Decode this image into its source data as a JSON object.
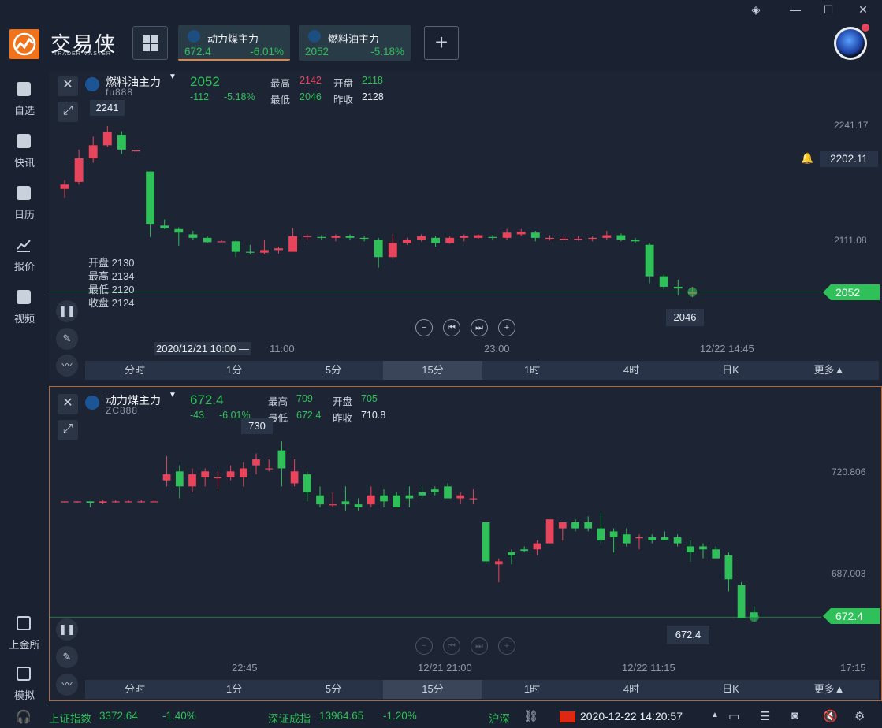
{
  "app": {
    "logo_text": "交易侠",
    "logo_sub": "TRADER MASTER"
  },
  "tabs": [
    {
      "name": "动力煤主力",
      "price": "672.4",
      "pct": "-6.01%"
    },
    {
      "name": "燃料油主力",
      "price": "2052",
      "pct": "-5.18%"
    }
  ],
  "add_tab_label": "+",
  "sidebar": [
    {
      "label": "自选"
    },
    {
      "label": "快讯"
    },
    {
      "label": "日历"
    },
    {
      "label": "报价"
    },
    {
      "label": "视频"
    },
    {
      "label": "上金所"
    },
    {
      "label": "模拟"
    }
  ],
  "panel1": {
    "name": "燃料油主力",
    "code": "fu888",
    "price": "2052",
    "change": "-112",
    "pct": "-5.18%",
    "high_label": "最高",
    "high": "2142",
    "low_label": "最低",
    "low": "2046",
    "open_label": "开盘",
    "open": "2118",
    "prev_label": "昨收",
    "prev": "2128",
    "max_tip": "2241",
    "min_tip": "2046",
    "y_labels": [
      "2241.17",
      "2111.08"
    ],
    "alert_price": "2202.11",
    "last_tag": "2052",
    "ohlc": [
      "开盘 2130",
      "最高 2134",
      "最低 2120",
      "收盘 2124"
    ],
    "x_labels": [
      "2020/12/21 10:00 —",
      "11:00",
      "23:00",
      "12/22 14:45"
    ],
    "timeframes": [
      "分时",
      "1分",
      "5分",
      "15分",
      "1时",
      "4时",
      "日K",
      "更多▲"
    ],
    "active_tf": "15分",
    "up_color": "#e8455d",
    "down_color": "#2fc05a"
  },
  "panel2": {
    "name": "动力煤主力",
    "code": "ZC888",
    "price": "672.4",
    "change": "-43",
    "pct": "-6.01%",
    "high_label": "最高",
    "high": "709",
    "low_label": "最低",
    "low": "672.4",
    "open_label": "开盘",
    "open": "705",
    "prev_label": "昨收",
    "prev": "710.8",
    "max_tip": "730",
    "min_tip": "672.4",
    "y_labels": [
      "720.806",
      "687.003"
    ],
    "last_tag": "672.4",
    "x_labels": [
      "22:45",
      "12/21 21:00",
      "12/22 11:15",
      "17:15"
    ],
    "timeframes": [
      "分时",
      "1分",
      "5分",
      "15分",
      "1时",
      "4时",
      "日K",
      "更多▲"
    ],
    "active_tf": "15分"
  },
  "statusbar": {
    "idx1_name": "上证指数",
    "idx1_val": "3372.64",
    "idx1_pct": "-1.40%",
    "idx2_name": "深证成指",
    "idx2_val": "13964.65",
    "idx2_pct": "-1.20%",
    "idx3_name": "沪深",
    "datetime": "2020-12-22 14:20:57"
  },
  "chart_data": [
    {
      "type": "candlestick",
      "title": "燃料油主力",
      "ylim": [
        2030,
        2260
      ],
      "candles": [
        [
          2170,
          2180,
          2160,
          2175
        ],
        [
          2178,
          2215,
          2175,
          2205
        ],
        [
          2205,
          2230,
          2200,
          2220
        ],
        [
          2220,
          2242,
          2218,
          2235
        ],
        [
          2232,
          2236,
          2210,
          2215
        ],
        [
          2214,
          2215,
          2212,
          2214
        ],
        [
          2190,
          2190,
          2115,
          2130
        ],
        [
          2128,
          2135,
          2124,
          2125
        ],
        [
          2124,
          2126,
          2105,
          2120
        ],
        [
          2118,
          2122,
          2112,
          2114
        ],
        [
          2114,
          2116,
          2108,
          2109
        ],
        [
          2110,
          2112,
          2109,
          2110
        ],
        [
          2110,
          2112,
          2092,
          2098
        ],
        [
          2098,
          2106,
          2095,
          2097
        ],
        [
          2097,
          2112,
          2095,
          2100
        ],
        [
          2100,
          2104,
          2096,
          2102
        ],
        [
          2098,
          2125,
          2098,
          2116
        ],
        [
          2115,
          2118,
          2111,
          2116
        ],
        [
          2115,
          2117,
          2112,
          2114
        ],
        [
          2114,
          2118,
          2110,
          2116
        ],
        [
          2116,
          2118,
          2112,
          2114
        ],
        [
          2114,
          2116,
          2110,
          2113
        ],
        [
          2112,
          2114,
          2080,
          2092
        ],
        [
          2092,
          2118,
          2090,
          2108
        ],
        [
          2108,
          2114,
          2106,
          2112
        ],
        [
          2112,
          2118,
          2110,
          2116
        ],
        [
          2114,
          2116,
          2104,
          2108
        ],
        [
          2108,
          2116,
          2107,
          2114
        ],
        [
          2114,
          2118,
          2110,
          2116
        ],
        [
          2114,
          2118,
          2113,
          2117
        ],
        [
          2115,
          2117,
          2112,
          2114
        ],
        [
          2114,
          2124,
          2112,
          2120
        ],
        [
          2118,
          2124,
          2116,
          2121
        ],
        [
          2120,
          2122,
          2110,
          2114
        ],
        [
          2114,
          2117,
          2111,
          2114
        ],
        [
          2113,
          2116,
          2111,
          2113
        ],
        [
          2113,
          2116,
          2111,
          2113
        ],
        [
          2113,
          2116,
          2110,
          2114
        ],
        [
          2114,
          2122,
          2112,
          2117
        ],
        [
          2117,
          2119,
          2110,
          2112
        ],
        [
          2112,
          2114,
          2108,
          2110
        ],
        [
          2106,
          2108,
          2062,
          2070
        ],
        [
          2070,
          2072,
          2055,
          2058
        ],
        [
          2058,
          2066,
          2048,
          2056
        ],
        [
          2050,
          2058,
          2046,
          2052
        ]
      ]
    },
    {
      "type": "candlestick",
      "title": "动力煤主力",
      "ylim": [
        668,
        735
      ],
      "candles": [
        [
          711,
          711,
          710.5,
          711
        ],
        [
          711,
          711,
          710.5,
          711
        ],
        [
          711,
          711,
          709,
          710.5
        ],
        [
          710.5,
          711.5,
          710,
          711
        ],
        [
          711,
          711.5,
          710.5,
          711
        ],
        [
          711,
          711.5,
          710.5,
          711
        ],
        [
          711,
          711.5,
          710.5,
          711
        ],
        [
          711,
          711.5,
          710.5,
          711
        ],
        [
          718,
          726,
          716,
          720
        ],
        [
          721,
          723,
          712,
          716
        ],
        [
          716,
          722,
          714,
          720
        ],
        [
          719,
          722,
          716,
          721
        ],
        [
          719,
          721,
          715,
          719
        ],
        [
          719,
          723,
          718,
          721
        ],
        [
          719,
          724,
          716,
          722
        ],
        [
          723,
          727,
          720,
          725
        ],
        [
          722,
          725,
          721,
          722
        ],
        [
          728,
          731,
          716,
          722
        ],
        [
          717,
          725,
          716,
          721
        ],
        [
          720,
          721,
          711,
          714
        ],
        [
          713,
          716,
          709,
          710
        ],
        [
          710,
          714,
          709,
          710
        ],
        [
          711,
          716,
          708,
          710
        ],
        [
          710,
          712,
          708,
          709
        ],
        [
          710,
          716,
          709,
          713
        ],
        [
          713,
          715,
          709,
          711
        ],
        [
          713,
          714,
          709,
          709
        ],
        [
          713,
          716,
          709,
          712
        ],
        [
          714,
          716,
          712,
          713
        ],
        [
          715,
          716,
          713,
          714
        ],
        [
          716,
          717,
          712,
          712
        ],
        [
          712,
          714,
          710,
          713
        ],
        [
          712,
          715,
          710,
          712
        ],
        [
          704,
          704,
          690,
          691
        ],
        [
          690,
          692,
          684,
          691
        ],
        [
          694,
          695,
          690,
          693
        ],
        [
          695,
          696,
          694,
          694.5
        ],
        [
          695,
          698,
          693,
          697
        ],
        [
          697,
          704,
          697,
          705
        ],
        [
          702,
          704,
          698,
          704
        ],
        [
          704,
          705,
          701,
          702
        ],
        [
          704,
          706,
          701,
          702
        ],
        [
          702,
          707,
          697,
          698
        ],
        [
          701,
          702,
          694,
          699
        ],
        [
          700,
          702,
          696,
          697
        ],
        [
          699,
          700,
          695,
          699
        ],
        [
          699,
          700,
          697,
          698
        ],
        [
          699,
          701,
          698,
          698
        ],
        [
          699,
          700,
          696,
          697
        ],
        [
          696,
          698,
          691,
          694
        ],
        [
          696,
          697,
          692,
          695
        ],
        [
          695,
          696,
          693,
          692
        ],
        [
          693,
          694,
          681,
          685
        ],
        [
          683,
          684,
          672,
          672
        ],
        [
          674,
          676,
          671,
          672.4
        ]
      ]
    }
  ]
}
